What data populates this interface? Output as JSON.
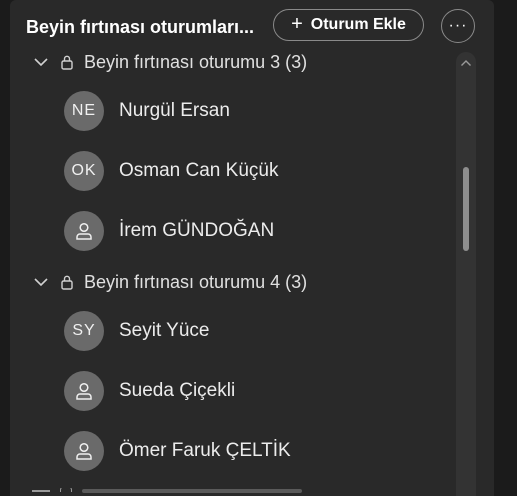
{
  "header": {
    "title": "Beyin fırtınası oturumları...",
    "add_button_icon": "plus-icon",
    "add_button_label": "Oturum Ekle",
    "more_icon": "more-options-icon",
    "more_label": "···"
  },
  "groups": [
    {
      "label": "Beyin fırtınası oturumu 3 (3)",
      "expanded": true,
      "members": [
        {
          "initials": "NE",
          "name": "Nurgül Ersan",
          "avatar": "initials"
        },
        {
          "initials": "OK",
          "name": "Osman Can Küçük",
          "avatar": "initials"
        },
        {
          "initials": "",
          "name": "İrem GÜNDOĞAN",
          "avatar": "person-icon"
        }
      ]
    },
    {
      "label": "Beyin fırtınası oturumu 4 (3)",
      "expanded": true,
      "members": [
        {
          "initials": "SY",
          "name": "Seyit Yüce",
          "avatar": "initials"
        },
        {
          "initials": "",
          "name": "Sueda Çiçekli",
          "avatar": "person-icon"
        },
        {
          "initials": "",
          "name": "Ömer Faruk ÇELTİK",
          "avatar": "person-icon"
        }
      ]
    }
  ],
  "colors": {
    "background": "#1b1b1b",
    "panel": "#292929",
    "avatar": "#6a6a6a",
    "text": "#ececec"
  }
}
